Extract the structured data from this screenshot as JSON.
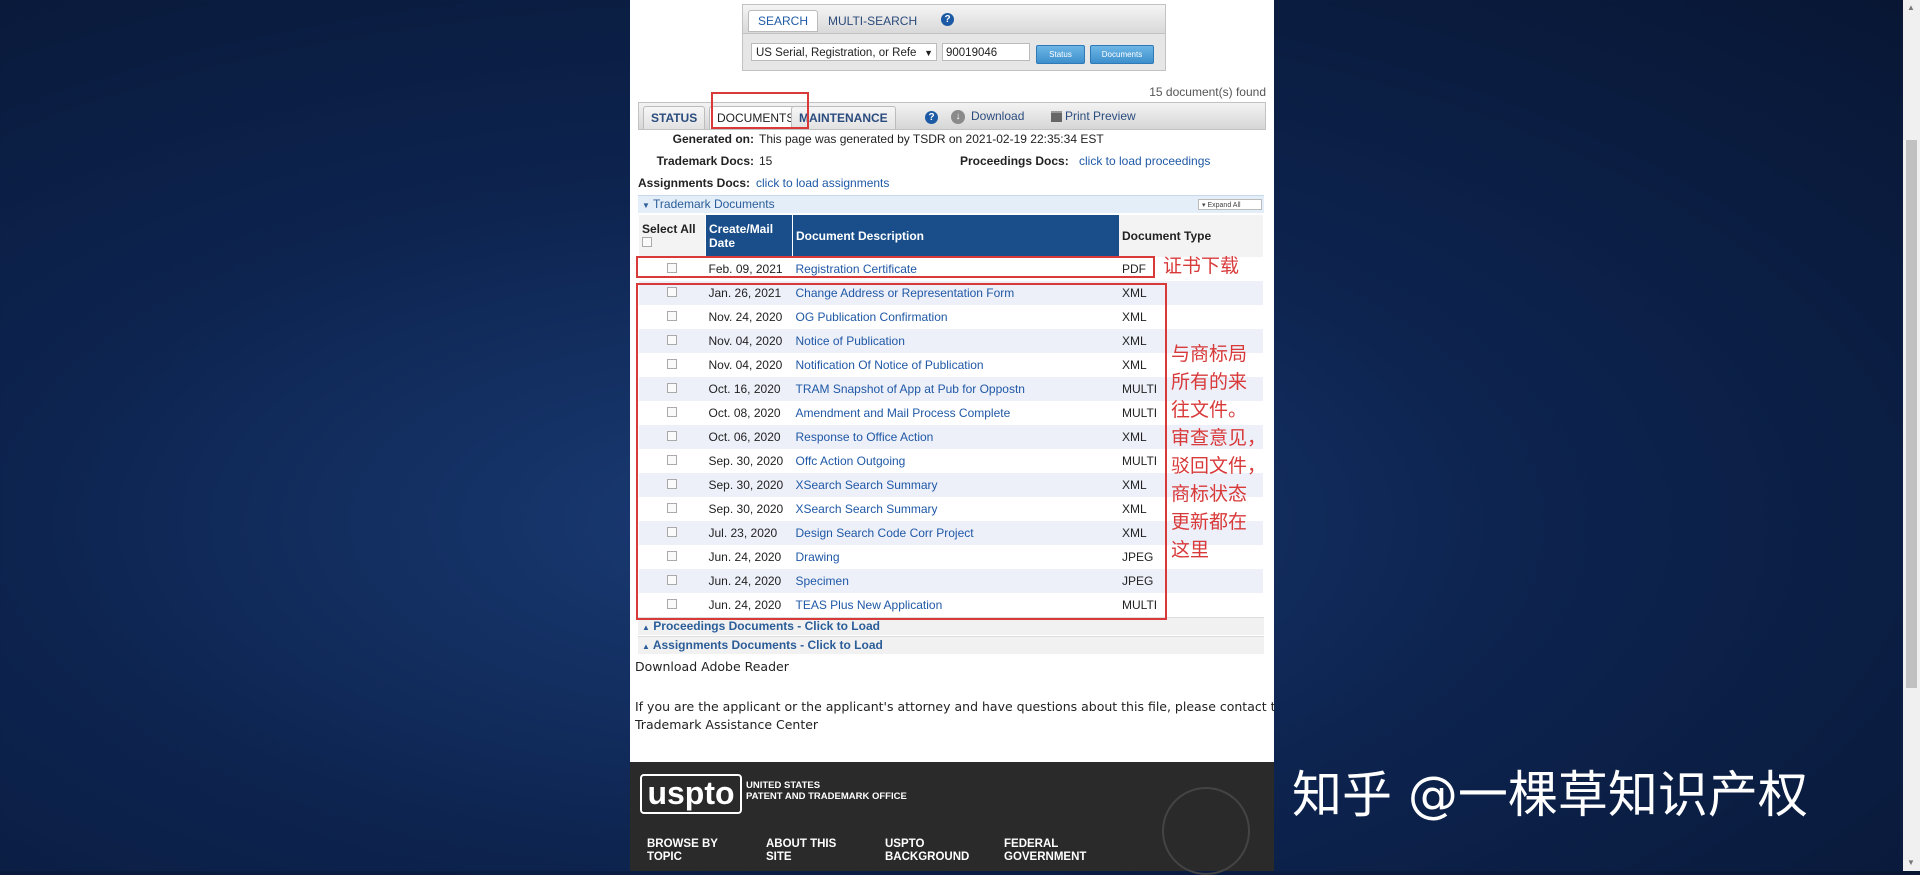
{
  "search": {
    "tab_search": "SEARCH",
    "tab_multi": "MULTI-SEARCH",
    "help": "?",
    "select_value": "US Serial, Registration, or Refe",
    "input_value": "90019046",
    "status_button": "Status",
    "documents_button": "Documents"
  },
  "found_text": "15 document(s) found",
  "tabs": {
    "status": "STATUS",
    "documents": "DOCUMENTS",
    "maintenance": "MAINTENANCE",
    "help": "?",
    "download": "Download",
    "print": "Print Preview"
  },
  "info": {
    "generated_label": "Generated on:",
    "generated_value": "This page was generated by TSDR on 2021-02-19 22:35:34 EST",
    "tm_docs_label": "Trademark Docs:",
    "tm_docs_value": "15",
    "proc_docs_label": "Proceedings Docs:",
    "proc_docs_value": "click to load proceedings",
    "assign_docs_label": "Assignments Docs:",
    "assign_docs_value": "click to load assignments"
  },
  "section": {
    "title": "Trademark Documents",
    "expand_all": "Expand All"
  },
  "table": {
    "headers": {
      "select_all": "Select All",
      "date": "Create/Mail Date",
      "description": "Document Description",
      "type": "Document Type"
    },
    "rows": [
      {
        "date": "Feb. 09, 2021",
        "desc": "Registration Certificate",
        "type": "PDF"
      },
      {
        "date": "Jan. 26, 2021",
        "desc": "Change Address or Representation Form",
        "type": "XML"
      },
      {
        "date": "Nov. 24, 2020",
        "desc": "OG Publication Confirmation",
        "type": "XML"
      },
      {
        "date": "Nov. 04, 2020",
        "desc": "Notice of Publication",
        "type": "XML"
      },
      {
        "date": "Nov. 04, 2020",
        "desc": "Notification Of Notice of Publication",
        "type": "XML"
      },
      {
        "date": "Oct. 16, 2020",
        "desc": "TRAM Snapshot of App at Pub for Oppostn",
        "type": "MULTI"
      },
      {
        "date": "Oct. 08, 2020",
        "desc": "Amendment and Mail Process Complete",
        "type": "MULTI"
      },
      {
        "date": "Oct. 06, 2020",
        "desc": "Response to Office Action",
        "type": "XML"
      },
      {
        "date": "Sep. 30, 2020",
        "desc": "Offc Action Outgoing",
        "type": "MULTI"
      },
      {
        "date": "Sep. 30, 2020",
        "desc": "XSearch Search Summary",
        "type": "XML"
      },
      {
        "date": "Sep. 30, 2020",
        "desc": "XSearch Search Summary",
        "type": "XML"
      },
      {
        "date": "Jul. 23, 2020",
        "desc": "Design Search Code Corr Project",
        "type": "XML"
      },
      {
        "date": "Jun. 24, 2020",
        "desc": "Drawing",
        "type": "JPEG"
      },
      {
        "date": "Jun. 24, 2020",
        "desc": "Specimen",
        "type": "JPEG"
      },
      {
        "date": "Jun. 24, 2020",
        "desc": "TEAS Plus New Application",
        "type": "MULTI"
      }
    ]
  },
  "proceedings_hdr": "Proceedings Documents - Click to Load",
  "assignments_hdr": "Assignments Documents - Click to Load",
  "adobe_link": "Download Adobe Reader",
  "contact_text": "If you are the applicant or the applicant's attorney and have questions about this file, please contact the",
  "assist_link": "Trademark Assistance Center",
  "annotations": {
    "cert": "证书下载",
    "files": [
      "与商标局",
      "所有的来",
      "往文件。",
      "审查意见，",
      "驳回文件，",
      "商标状态",
      "更新都在",
      "这里"
    ]
  },
  "footer": {
    "logo": "uspto",
    "org_line1": "UNITED STATES",
    "org_line2": "PATENT AND TRADEMARK OFFICE",
    "nav": [
      {
        "l1": "BROWSE BY",
        "l2": "TOPIC"
      },
      {
        "l1": "ABOUT THIS",
        "l2": "SITE"
      },
      {
        "l1": "USPTO",
        "l2": "BACKGROUND"
      },
      {
        "l1": "FEDERAL",
        "l2": "GOVERNMENT"
      }
    ]
  },
  "watermark": "知乎 @一棵草知识产权",
  "colors": {
    "annotation_red": "#d83a3a",
    "header_blue": "#1a4e8a",
    "link_blue": "#1f58a6"
  }
}
